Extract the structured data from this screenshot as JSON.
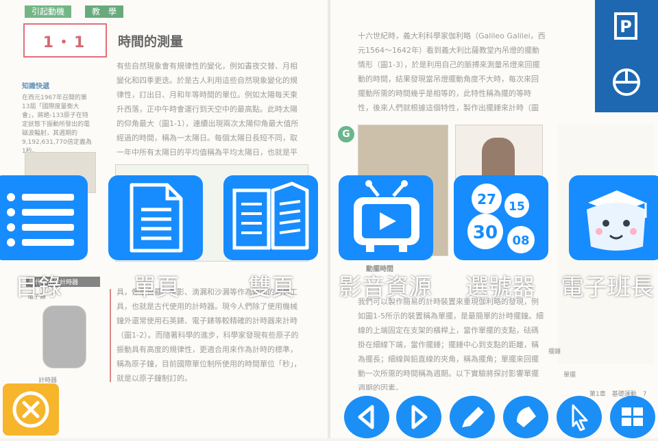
{
  "textbook": {
    "left": {
      "tab1": "引起動機",
      "tab2": "教　學",
      "section_number": "1・1",
      "section_title": "時間的測量",
      "sidebar_heading": "知識快遞",
      "sidebar_text": "在西元1967年召開的第13屆「國際度量衡大會」，將絶-133原子在特定狀態下振動所發出的電磁波輻射，其週期的9,192,631,770倍定義為1秒。",
      "paragraph1": "有些自然現象會有規律性的變化，例如晝夜交替、月相變化和四季更迭。於是古人利用這些自然現象變化的規律性，訂出日、月和年等時間的單位。例如太陽每天東升西落，正中午時會運行到天空中的最高點。此時太陽的仰角最大（圖1-1），連續出現兩次太陽仰角最大值所經過的時間，稱為一太陽日。每個太陽日長短不同，取一年中所有太陽日的平均值稱為平均太陽日，也就是平常所稱的一天或一日。",
      "paragraph2": "具，像是日晷、竿影、滴漏和沙漏等作為時間的測量工具，也就是古代使用的計時器。現今人們除了使用機械鐘外還常使用石英錶、電子錶等較精確的計時器來計時（圖1-2）。而隨著科學的進步，科學家發現有些原子的振動具有高度的規律性，更適合用來作為計時的標準，稱為原子鐘，目前國際單位制所使用的時間單位「秒」，就是以原子鐘制訂的。",
      "caption_watch": "現代常用的計時器",
      "label_watch": "電子錶",
      "caption_timer": "計時器"
    },
    "right": {
      "paragraph1": "十六世紀時，義大利科學家伽利略（Galileo Galilei，西元1564～1642年）看到義大利比薩教堂內吊燈的擺動情形（圖1-3），於是利用自己的脈搏來測量吊燈來回擺動的時間，結果發現當吊燈擺動角度不大時，每次來回擺動所需的時間幾乎是相等的，此特性稱為擺的等時性，後來人們就根據這個特性，製作出擺錘來計時（圖1-4）。",
      "section_heading": "動擺時間",
      "paragraph2": "我們可以製作簡易的計時裝置來重現伽利略的發現，例如圖1-5所示的裝置稱為單擺，是最簡單的計時擺鐘。細線的上端固定在支架的橫桿上，當作單擺的支點，砝碼掛在細線下端，當作擺錘；擺錘中心到支點的距離，稱為擺長；細線與鉛直線的夾角，稱為擺角；單擺來回擺動一次所需的時間稱為週期。以下實驗將探討影響單擺週期的因素。",
      "label_pendulum": "擺錘",
      "caption_pendulum": "單擺",
      "footer": "第1章　基礎運動　7"
    },
    "g_badge": "G"
  },
  "right_toolbar": {
    "items": [
      {
        "name": "powerpoint",
        "label": "P"
      },
      {
        "name": "pie-chart",
        "label": ""
      }
    ]
  },
  "menu": {
    "items": [
      {
        "label": "目錄",
        "icon": "list-icon"
      },
      {
        "label": "單頁",
        "icon": "single-page-icon"
      },
      {
        "label": "雙頁",
        "icon": "double-page-icon"
      },
      {
        "label": "影音資源",
        "icon": "tv-icon"
      },
      {
        "label": "選號器",
        "icon": "number-balls-icon"
      },
      {
        "label": "電子班長",
        "icon": "class-leader-icon"
      }
    ],
    "numbers": [
      "27",
      "15",
      "30",
      "08"
    ]
  },
  "close_button": {
    "icon": "close-icon",
    "color": "#f7b52c"
  },
  "bottom_toolbar": {
    "buttons": [
      "previous-icon",
      "next-icon",
      "pen-icon",
      "eraser-icon",
      "pointer-icon",
      "grid-icon"
    ]
  },
  "colors": {
    "accent_blue": "#168cff",
    "panel_blue": "#1e68b2",
    "close_yellow": "#f7b52c",
    "tab_green": "#3d9a55"
  }
}
